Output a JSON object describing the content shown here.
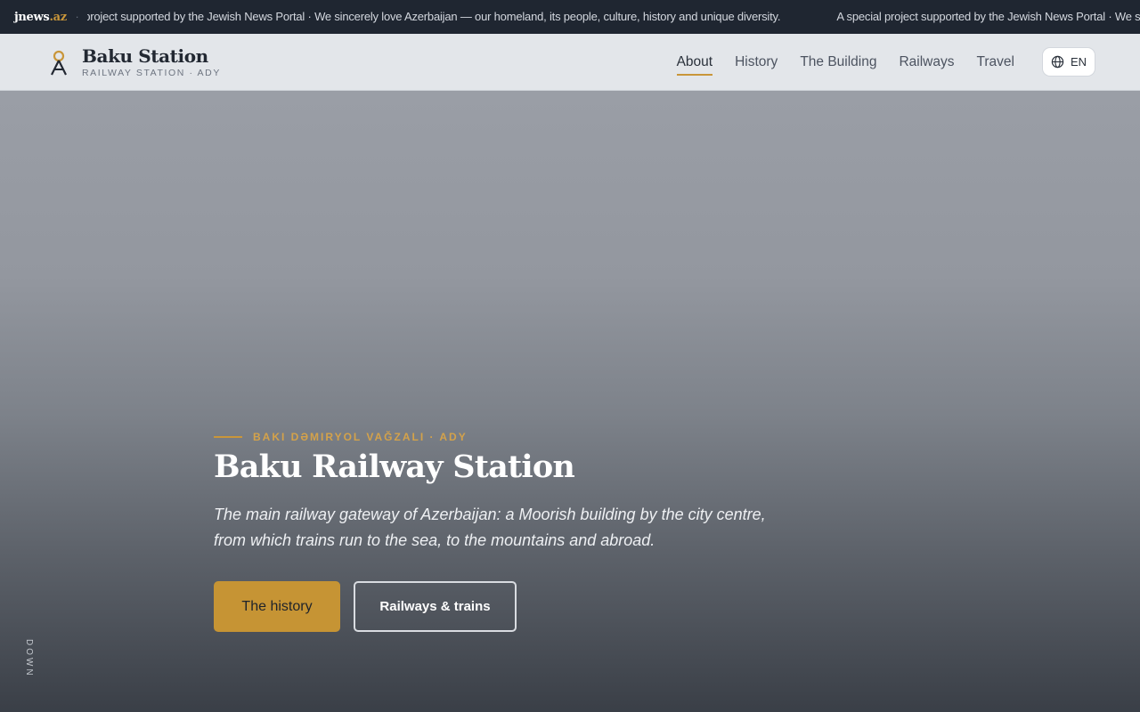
{
  "ticker": {
    "logo_main": "jnews",
    "logo_tld": ".az",
    "separator": "·",
    "message_visible_start": "t project supported by the Jewish News Portal · We sincerely love Azerbaijan — our homeland, its people, culture, history and unique diversity.",
    "message_repeat": "A special project supported by the Jewish News Portal · We sincerely love Azerbaijan — our homeland, its people, culture, history and unique diversity."
  },
  "header": {
    "brand_title": "Baku Station",
    "brand_subtitle": "RAILWAY STATION · ADY",
    "nav": [
      {
        "label": "About",
        "active": true
      },
      {
        "label": "History",
        "active": false
      },
      {
        "label": "The Building",
        "active": false
      },
      {
        "label": "Railways",
        "active": false
      },
      {
        "label": "Travel",
        "active": false
      }
    ],
    "language": "EN"
  },
  "hero": {
    "eyebrow": "BAKI DƏMIRYOL VAĞZALI · ADY",
    "title": "Baku Railway Station",
    "description": "The main railway gateway of Azerbaijan: a Moorish building by the city centre, from which trains run to the sea, to the mountains and abroad.",
    "primary_button": "The history",
    "secondary_button": "Railways & trains",
    "scroll_hint": "DOWN"
  },
  "colors": {
    "accent": "#c69434",
    "ticker_bg": "#1f2631",
    "header_bg": "#e3e6ea",
    "text_dark": "#222832"
  },
  "icons": {
    "brand": "station-lamp-icon",
    "language": "globe-icon"
  }
}
